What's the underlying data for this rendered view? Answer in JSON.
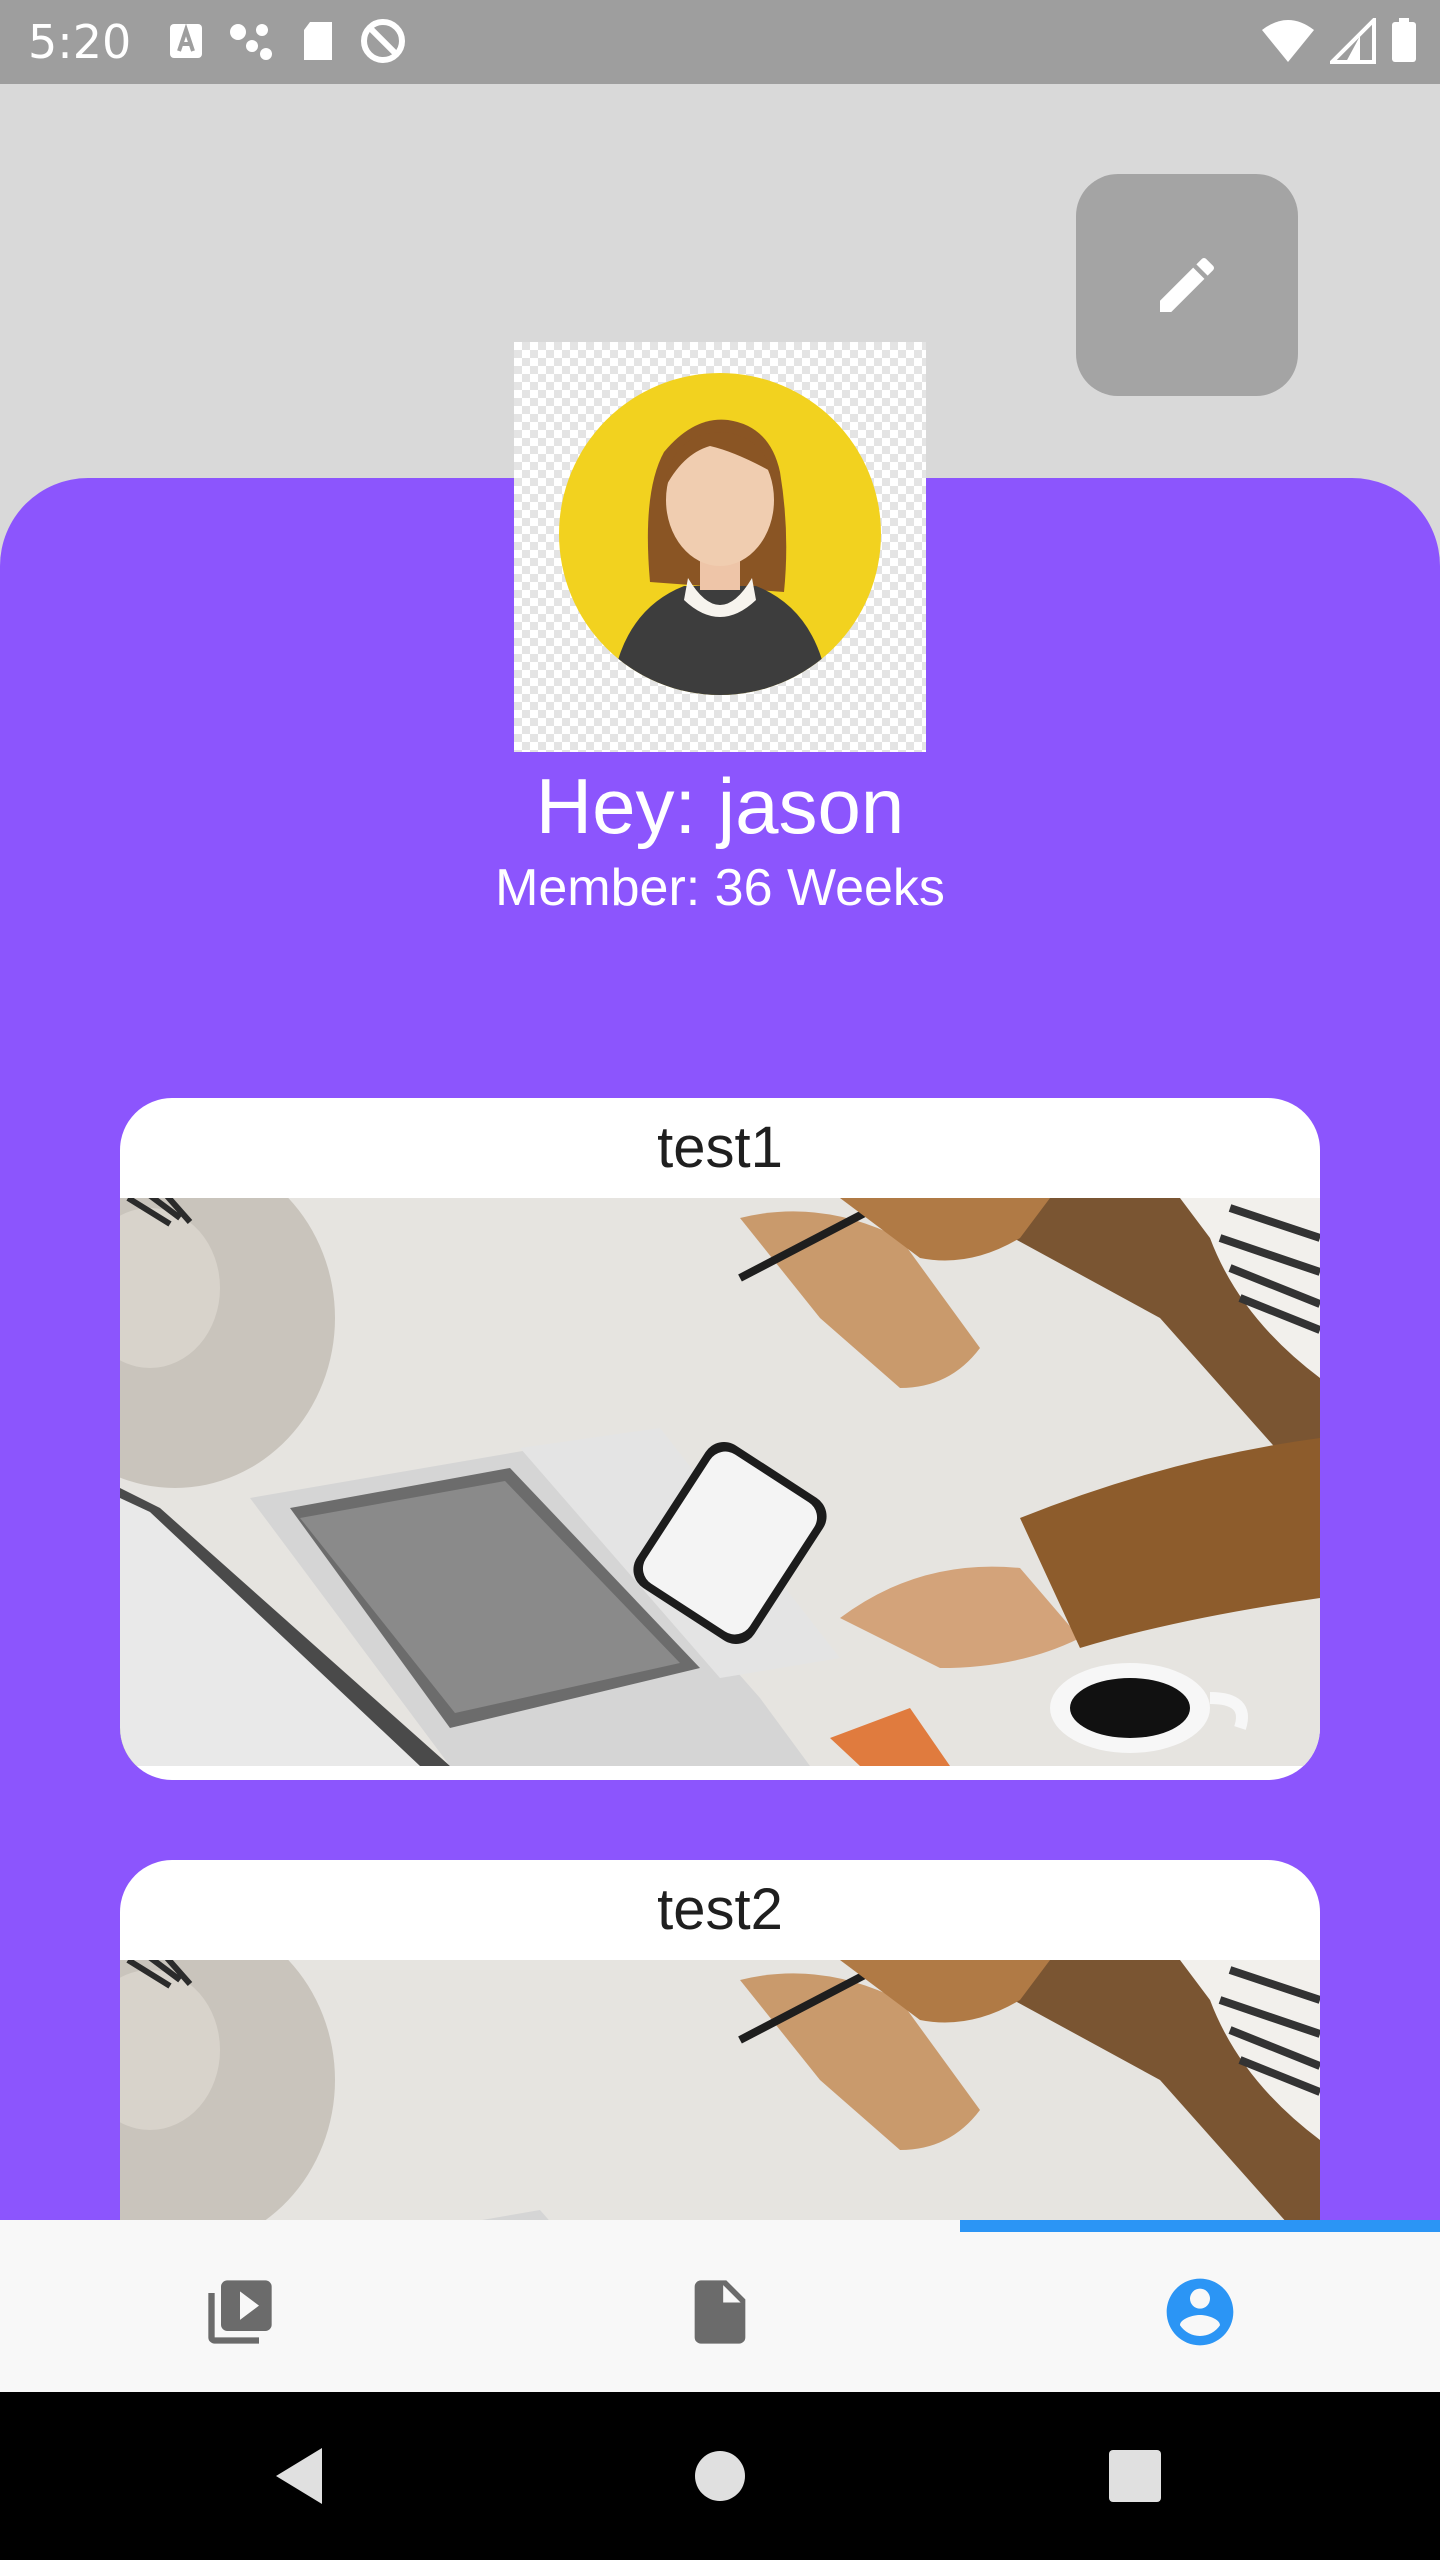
{
  "status_bar": {
    "time": "5:20",
    "left_icons": [
      "a-icon",
      "share-dots-icon",
      "sd-card-icon",
      "no-disturb-icon"
    ],
    "right_icons": [
      "wifi-icon",
      "signal-icon",
      "battery-icon"
    ]
  },
  "header": {
    "edit_icon": "pencil-icon"
  },
  "profile": {
    "greeting": "Hey: jason",
    "member": "Member: 36 Weeks",
    "avatar_icon": "woman-avatar-icon"
  },
  "cards": [
    {
      "title": "test1",
      "image": "laptop-phone-desk-photo"
    },
    {
      "title": "test2",
      "image": "laptop-phone-desk-photo"
    }
  ],
  "bottom_nav": {
    "items": [
      {
        "icon": "video-library-icon",
        "active": false
      },
      {
        "icon": "document-icon",
        "active": false
      },
      {
        "icon": "account-circle-icon",
        "active": true
      }
    ]
  },
  "system_nav": {
    "icons": [
      "back-icon",
      "home-icon",
      "recents-icon"
    ]
  },
  "colors": {
    "panel": "#8c55fd",
    "background": "#d9d9d9",
    "accent": "#2b95f5",
    "avatar_circle": "#f2d21f"
  }
}
